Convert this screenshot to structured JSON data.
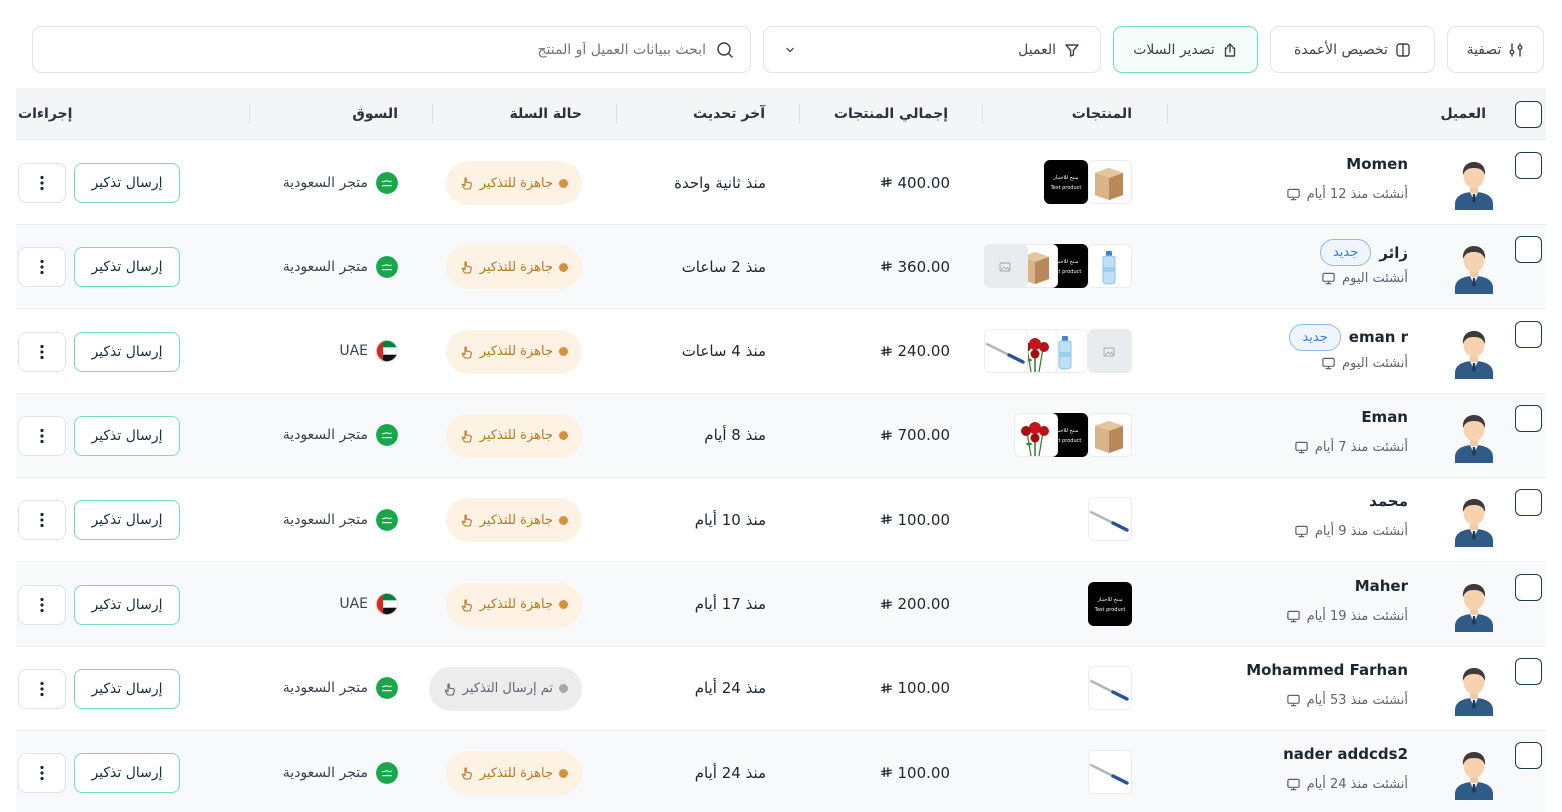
{
  "toolbar": {
    "search_placeholder": "ابحث ببيانات العميل أو المنتج",
    "customer_filter_label": "العميل",
    "export_label": "تصدير السلات",
    "columns_label": "تخصيص الأعمدة",
    "filter_label": "تصفية"
  },
  "columns": {
    "customer": "العميل",
    "products": "المنتجات",
    "total": "إجمالي المنتجات",
    "updated": "آخر تحديث",
    "status": "حالة السلة",
    "market": "السوق",
    "actions": "إجراءات"
  },
  "currency_icon": "riyal-symbol",
  "rows": [
    {
      "name": "Momen",
      "badge": "",
      "created": "أنشئت منذ 12 أيام",
      "products": [
        "box",
        "black"
      ],
      "total": "400.00",
      "updated": "منذ ثانية واحدة",
      "status": "جاهزة للتذكير",
      "status_type": "ready",
      "market": "متجر السعودية",
      "flag": "sa",
      "action": "إرسال تذكير"
    },
    {
      "name": "زائر",
      "badge": "جديد",
      "created": "أنشئت اليوم",
      "products": [
        "bottle",
        "black",
        "box",
        "placeholder"
      ],
      "total": "360.00",
      "updated": "منذ 2 ساعات",
      "status": "جاهزة للتذكير",
      "status_type": "ready",
      "market": "متجر السعودية",
      "flag": "sa",
      "action": "إرسال تذكير"
    },
    {
      "name": "eman r",
      "badge": "جديد",
      "created": "أنشئت اليوم",
      "products": [
        "placeholder",
        "bottle",
        "rose",
        "pen"
      ],
      "total": "240.00",
      "updated": "منذ 4 ساعات",
      "status": "جاهزة للتذكير",
      "status_type": "ready",
      "market": "UAE",
      "flag": "ae",
      "action": "إرسال تذكير"
    },
    {
      "name": "Eman",
      "badge": "",
      "created": "أنشئت منذ 7 أيام",
      "products": [
        "box",
        "black",
        "rose"
      ],
      "total": "700.00",
      "updated": "منذ 8 أيام",
      "status": "جاهزة للتذكير",
      "status_type": "ready",
      "market": "متجر السعودية",
      "flag": "sa",
      "action": "إرسال تذكير"
    },
    {
      "name": "محمد",
      "badge": "",
      "created": "أنشئت منذ 9 أيام",
      "products": [
        "pen"
      ],
      "total": "100.00",
      "updated": "منذ 10 أيام",
      "status": "جاهزة للتذكير",
      "status_type": "ready",
      "market": "متجر السعودية",
      "flag": "sa",
      "action": "إرسال تذكير"
    },
    {
      "name": "Maher",
      "badge": "",
      "created": "أنشئت منذ 19 أيام",
      "products": [
        "black"
      ],
      "total": "200.00",
      "updated": "منذ 17 أيام",
      "status": "جاهزة للتذكير",
      "status_type": "ready",
      "market": "UAE",
      "flag": "ae",
      "action": "إرسال تذكير"
    },
    {
      "name": "Mohammed Farhan",
      "badge": "",
      "created": "أنشئت منذ 53 أيام",
      "products": [
        "pen"
      ],
      "total": "100.00",
      "updated": "منذ 24 أيام",
      "status": "تم إرسال التذكير",
      "status_type": "sent",
      "market": "متجر السعودية",
      "flag": "sa",
      "action": "إرسال تذكير"
    },
    {
      "name": "nader addcds2",
      "badge": "",
      "created": "أنشئت منذ 24 أيام",
      "products": [
        "pen"
      ],
      "total": "100.00",
      "updated": "منذ 24 أيام",
      "status": "جاهزة للتذكير",
      "status_type": "ready",
      "market": "متجر السعودية",
      "flag": "sa",
      "action": "إرسال تذكير"
    }
  ],
  "product_thumb_text": {
    "line1": "منتج للاختبار",
    "line2": "Test product"
  },
  "colors": {
    "accent": "#7ad9c6",
    "ready_bg": "#fdf2e4",
    "ready_text": "#b87823",
    "sent_bg": "#ececec",
    "badge_blue": "#3a7bd5",
    "checkbox_border": "#1f3a4d"
  }
}
